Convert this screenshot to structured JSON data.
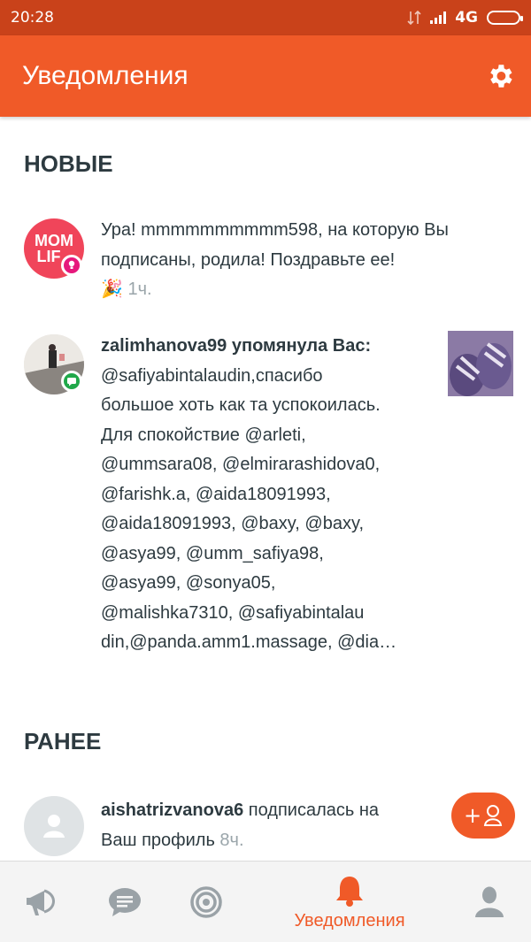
{
  "status_bar": {
    "time": "20:28",
    "network": "4G"
  },
  "app_bar": {
    "title": "Уведомления",
    "settings_icon": "gear-icon"
  },
  "sections": {
    "new_title": "НОВЫЕ",
    "earlier_title": "РАНЕЕ"
  },
  "notifications": [
    {
      "avatar_text_1": "MOM",
      "avatar_text_2": "LIF",
      "text": "Ура! mmmmmmmmmm598, на которую Вы подписаны, родила! Поздравьте ее!",
      "emoji": "🎉",
      "time": "1ч."
    },
    {
      "username": "zalimhanova99",
      "action": "упомянула Вас:",
      "body": "@safiyabintalaudin,спасибо большое хоть как та успокоилась. Для спокойствие @arleti, @ummsara08, @elmirarashidova0, @farishk.a, @aida18091993, @aida18091993, @baxy, @baxy, @asya99, @umm_safiya98, @asya99, @sonya05, @malishka7310, @safiyabintalau din,@panda.amm1.massage, @dia…",
      "lines": [
        "@safiyabintalaudin,спасибо",
        "большое хоть как та успокоилась.",
        "Для спокойствие @arleti,",
        "@ummsara08, @elmirarashidova0,",
        "@farishk.a, @aida18091993,",
        "@aida18091993, @baxy, @baxy,",
        "@asya99, @umm_safiya98,",
        "@asya99, @sonya05,",
        "@malishka7310, @safiyabintalau",
        "din,@panda.amm1.massage, @dia…"
      ]
    },
    {
      "username": "aishatrizvanova6",
      "action": "подписалась на",
      "action_2": "Ваш профиль",
      "time": "8ч.",
      "follow_button_label": "+"
    }
  ],
  "bottom_nav": {
    "active_label": "Уведомления",
    "items": [
      "megaphone-icon",
      "chat-icon",
      "target-icon",
      "bell-icon",
      "profile-icon"
    ]
  },
  "colors": {
    "accent": "#f05a28",
    "status_bar": "#c9421a",
    "badge_pink": "#e6187c",
    "badge_green": "#20a84a"
  }
}
